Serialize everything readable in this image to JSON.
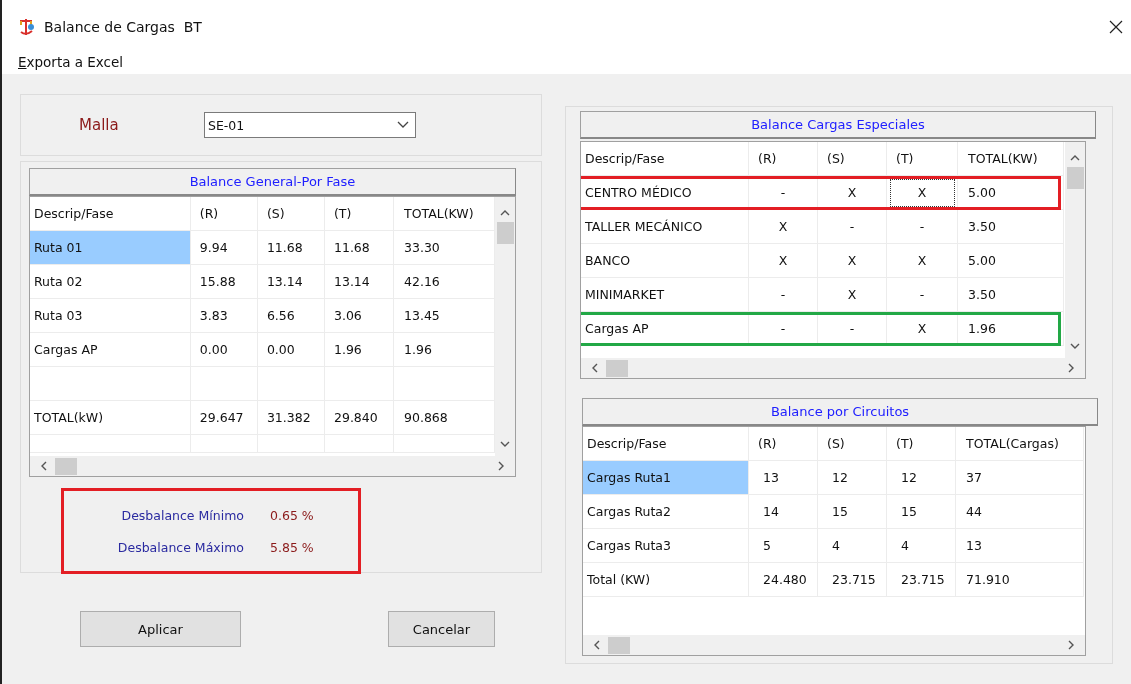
{
  "window": {
    "title": "Balance de Cargas  BT"
  },
  "menu": [
    "Exporta a Excel"
  ],
  "malla": {
    "label": "Malla",
    "value": "SE-01"
  },
  "general": {
    "title": "Balance General-Por Fase",
    "columns": [
      "Descrip/Fase",
      "(R)",
      "(S)",
      "(T)",
      "TOTAL(KW)"
    ],
    "rows": [
      {
        "kind": "data",
        "selected": true,
        "cells": [
          "Ruta 01",
          "9.94",
          "11.68",
          "11.68",
          "33.30"
        ]
      },
      {
        "kind": "data",
        "selected": false,
        "cells": [
          "Ruta 02",
          "15.88",
          "13.14",
          "13.14",
          "42.16"
        ]
      },
      {
        "kind": "data",
        "selected": false,
        "cells": [
          "Ruta 03",
          "3.83",
          "6.56",
          "3.06",
          "13.45"
        ]
      },
      {
        "kind": "data",
        "selected": false,
        "cells": [
          "Cargas AP",
          "0.00",
          "0.00",
          "1.96",
          "1.96"
        ]
      },
      {
        "kind": "blank"
      },
      {
        "kind": "data",
        "selected": false,
        "cells": [
          "TOTAL(kW)",
          "29.647",
          "31.382",
          "29.840",
          "90.868"
        ]
      }
    ]
  },
  "imbalance": {
    "color": "#e31e24",
    "items": [
      {
        "label": "Desbalance Mínimo",
        "value": "0.65 %"
      },
      {
        "label": "Desbalance Máximo",
        "value": "5.85 %"
      }
    ]
  },
  "buttons": [
    "Aplicar",
    "Cancelar"
  ],
  "especiales": {
    "title": "Balance Cargas Especiales",
    "columns": [
      "Descrip/Fase",
      "(R)",
      "(S)",
      "(T)",
      "TOTAL(KW)"
    ],
    "rows": [
      {
        "color": "#e31e24",
        "cells": [
          {
            "text": "CENTRO MÉDICO",
            "focused": false
          },
          {
            "text": "-",
            "focused": false
          },
          {
            "text": "X",
            "focused": false
          },
          {
            "text": "X",
            "focused": true
          },
          {
            "text": "5.00",
            "focused": false
          }
        ]
      },
      {
        "cells": [
          {
            "text": "TALLER MECÁNICO",
            "focused": false
          },
          {
            "text": "X",
            "focused": false
          },
          {
            "text": "-",
            "focused": false
          },
          {
            "text": "-",
            "focused": false
          },
          {
            "text": "3.50",
            "focused": false
          }
        ]
      },
      {
        "cells": [
          {
            "text": "BANCO",
            "focused": false
          },
          {
            "text": "X",
            "focused": false
          },
          {
            "text": "X",
            "focused": false
          },
          {
            "text": "X",
            "focused": false
          },
          {
            "text": "5.00",
            "focused": false
          }
        ]
      },
      {
        "cells": [
          {
            "text": "MINIMARKET",
            "focused": false
          },
          {
            "text": "-",
            "focused": false
          },
          {
            "text": "X",
            "focused": false
          },
          {
            "text": "-",
            "focused": false
          },
          {
            "text": "3.50",
            "focused": false
          }
        ]
      },
      {
        "color": "#22a846",
        "cells": [
          {
            "text": "Cargas AP",
            "focused": false
          },
          {
            "text": "-",
            "focused": false
          },
          {
            "text": "-",
            "focused": false
          },
          {
            "text": "X",
            "focused": false
          },
          {
            "text": "1.96",
            "focused": false
          }
        ]
      }
    ]
  },
  "circuitos": {
    "title": "Balance por Circuitos",
    "columns": [
      "Descrip/Fase",
      "(R)",
      "(S)",
      "(T)",
      "TOTAL(Cargas)"
    ],
    "rows": [
      {
        "selected": true,
        "cells": [
          "Cargas Ruta1",
          "13",
          "12",
          "12",
          "37"
        ]
      },
      {
        "selected": false,
        "cells": [
          "Cargas Ruta2",
          "14",
          "15",
          "15",
          "44"
        ]
      },
      {
        "selected": false,
        "cells": [
          "Cargas Ruta3",
          "5",
          "4",
          "4",
          "13"
        ]
      },
      {
        "selected": false,
        "cells": [
          "Total (KW)",
          "24.480",
          "23.715",
          "23.715",
          "71.910"
        ]
      }
    ]
  }
}
